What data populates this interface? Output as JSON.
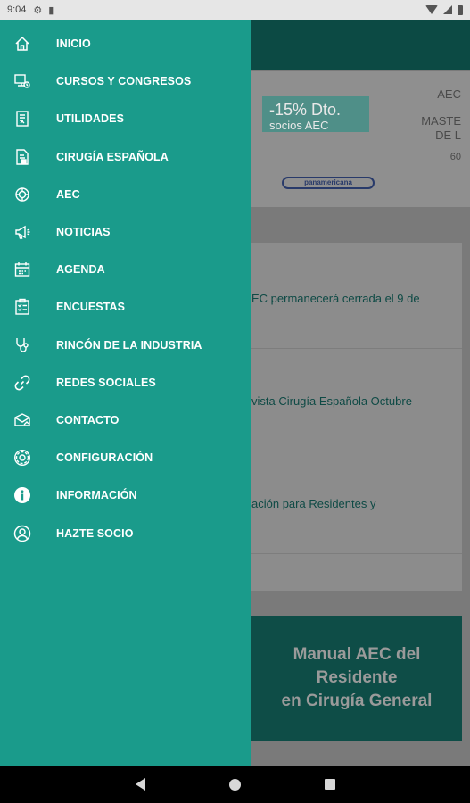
{
  "status_bar": {
    "time": "9:04"
  },
  "drawer": {
    "items": [
      {
        "label": "INICIO",
        "icon": "home-icon"
      },
      {
        "label": "CURSOS Y CONGRESOS",
        "icon": "courses-icon"
      },
      {
        "label": "UTILIDADES",
        "icon": "utilities-icon"
      },
      {
        "label": "CIRUGÍA ESPAÑOLA",
        "icon": "journal-icon"
      },
      {
        "label": "AEC",
        "icon": "aec-icon"
      },
      {
        "label": "NOTICIAS",
        "icon": "megaphone-icon"
      },
      {
        "label": "AGENDA",
        "icon": "calendar-icon"
      },
      {
        "label": "ENCUESTAS",
        "icon": "survey-icon"
      },
      {
        "label": "RINCÓN DE LA INDUSTRIA",
        "icon": "stethoscope-icon"
      },
      {
        "label": "REDES SOCIALES",
        "icon": "link-icon"
      },
      {
        "label": "CONTACTO",
        "icon": "mail-icon"
      },
      {
        "label": "CONFIGURACIÓN",
        "icon": "gear-icon"
      },
      {
        "label": "INFORMACIÓN",
        "icon": "info-icon"
      },
      {
        "label": "HAZTE SOCIO",
        "icon": "user-icon"
      }
    ]
  },
  "background": {
    "banner": {
      "promo_main": "-15% Dto.",
      "promo_sub": "socios AEC",
      "logo": "panamericana",
      "side_top": "AEC",
      "side_mid1": "MASTE",
      "side_mid2": "DE L",
      "side_num": "60"
    },
    "news": [
      {
        "text": "EC permanecerá cerrada el 9 de"
      },
      {
        "text": "vista Cirugía Española Octubre"
      },
      {
        "text": "ación para Residentes y"
      }
    ],
    "manual": {
      "line1": "Manual AEC del Residente",
      "line2": "en Cirugía General"
    }
  },
  "colors": {
    "drawer": "#1a9b8b",
    "appbar": "#0c4a44",
    "text": "#ffffff"
  }
}
